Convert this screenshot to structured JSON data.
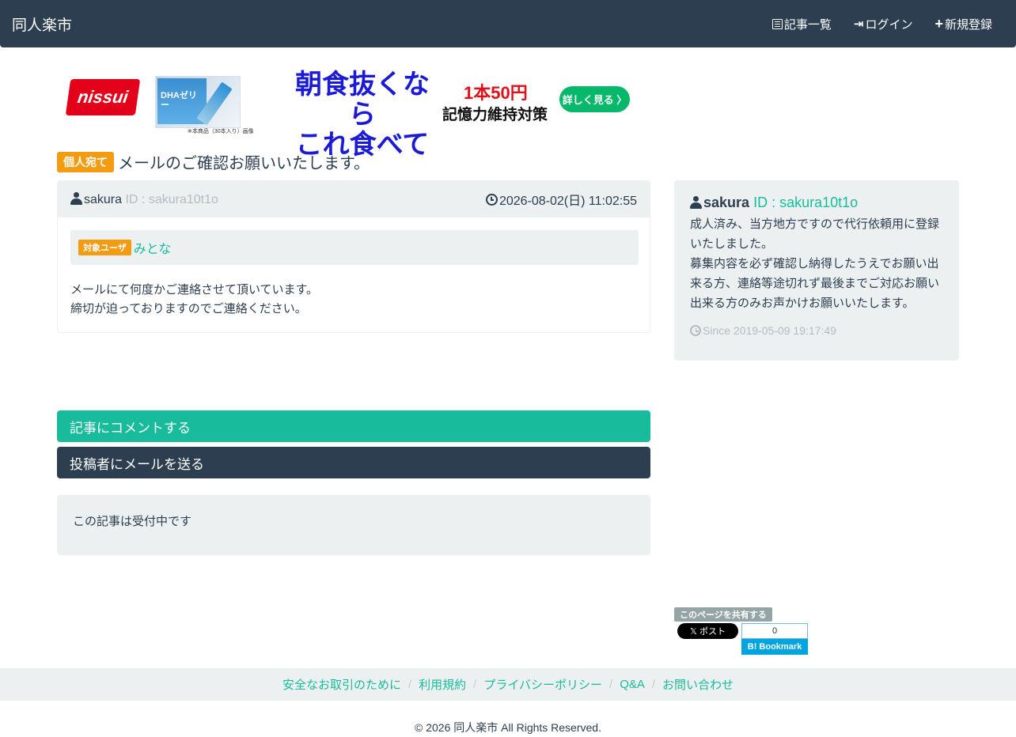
{
  "navbar": {
    "brand": "同人楽市",
    "items": [
      {
        "label": "記事一覧",
        "icon": "list-icon"
      },
      {
        "label": "ログイン",
        "icon": "login-icon"
      },
      {
        "label": "新規登録",
        "icon": "plus-icon"
      }
    ]
  },
  "ad": {
    "logo": "nissui",
    "product_text": "DHAゼリー",
    "product_note": "※本商品（30本入り）画像",
    "headline_line1": "朝食抜くなら",
    "headline_line2": "これ食べて",
    "price": "1本50円",
    "subline": "記憶力維持対策",
    "cta": "詳しく見る 〉"
  },
  "post": {
    "badge": "個人宛て",
    "title": "メールのご確認お願いいたします。",
    "author": "sakura",
    "author_id": "ID : sakura10t1o",
    "datetime": "2026-08-02(日) 11:02:55",
    "target_label": "対象ユーザ",
    "target_user": "みとな",
    "body_line1": "メールにて何度かご連絡させて頂いています。",
    "body_line2": "締切が迫っておりますのでご連絡ください。"
  },
  "actions": {
    "comment": "記事にコメントする",
    "mail": "投稿者にメールを送る",
    "status": "この記事は受付中です"
  },
  "profile": {
    "name": "sakura",
    "id": "ID : sakura10t1o",
    "line1": "成人済み、当方地方ですので代行依頼用に登録いたしました。",
    "line2": "募集内容を必ず確認し納得したうえでお願い出来る方、連絡等途切れず最後までご対応お願い出来る方のみお声かけお願いいたします。",
    "since": "Since 2019-05-09 19:17:49"
  },
  "share": {
    "label": "このページを共有する",
    "x_label": "𝕏 ポスト",
    "hatena_count": "0",
    "hatena_label": "B! Bookmark"
  },
  "footer": {
    "links": [
      "安全なお取引のために",
      "利用規約",
      "プライバシーポリシー",
      "Q&A",
      "お問い合わせ"
    ],
    "copyright": "© 2026 同人楽市 All Rights Reserved."
  },
  "colors": {
    "navbar": "#2c3e50",
    "accent_teal": "#18bc9c",
    "badge_orange": "#f39c12",
    "panel_gray": "#ecf0f1"
  }
}
